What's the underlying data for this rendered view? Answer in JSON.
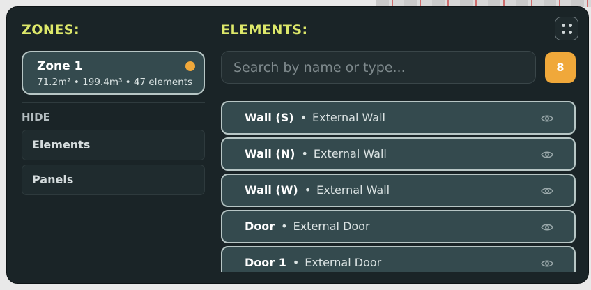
{
  "zones": {
    "heading": "ZONES:",
    "card": {
      "name": "Zone 1",
      "meta": "71.2m² • 199.4m³ • 47 elements",
      "status_color": "#f0a83a"
    },
    "hide": {
      "label": "HIDE",
      "buttons": [
        "Elements",
        "Panels"
      ]
    }
  },
  "elements": {
    "heading": "ELEMENTS:",
    "search_placeholder": "Search by name or type...",
    "count": "8",
    "rows": [
      {
        "name": "Wall (S)",
        "separator": "•",
        "type": "External Wall",
        "icon": "eye-icon"
      },
      {
        "name": "Wall (N)",
        "separator": "•",
        "type": "External Wall",
        "icon": "eye-icon"
      },
      {
        "name": "Wall (W)",
        "separator": "•",
        "type": "External Wall",
        "icon": "eye-icon"
      },
      {
        "name": "Door",
        "separator": "•",
        "type": "External Door",
        "icon": "eye-icon"
      },
      {
        "name": "Door 1",
        "separator": "•",
        "type": "External Door",
        "icon": "eye-icon"
      }
    ]
  },
  "toolbar": {
    "grid_icon": "grid-dots-icon"
  },
  "colors": {
    "accent": "#dde86a",
    "badge": "#f0a83a",
    "panel_bg": "#1a2427",
    "card_bg": "#344a4e"
  }
}
